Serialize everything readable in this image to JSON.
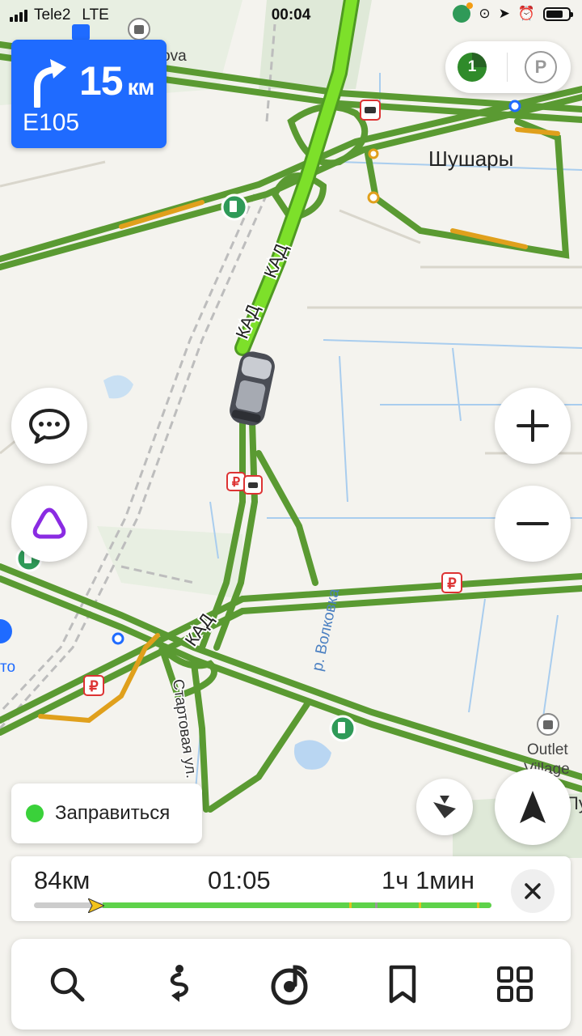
{
  "status_bar": {
    "carrier": "Tele2",
    "network": "LTE",
    "time": "00:04"
  },
  "maneuver": {
    "distance": "15",
    "unit": "км",
    "road": "E105"
  },
  "top_right": {
    "traffic_level": "1"
  },
  "map": {
    "place_shushary": "Шушары",
    "road_kad_1": "КАД",
    "road_kad_2": "КАД",
    "road_kad_3": "КАД",
    "river": "р. Волковка",
    "street": "Стартовая ул.",
    "street_partial_top": "ova",
    "outlet_line1": "Outlet",
    "outlet_line2": "Village",
    "left_edge_text": "то",
    "right_edge_text": "Пу"
  },
  "refuel_chip": {
    "label": "Заправиться"
  },
  "route": {
    "distance": "84км",
    "eta": "01:05",
    "duration": "1ч 1мин",
    "progress": 0.15
  },
  "colors": {
    "traffic_green": "#5a9a32",
    "traffic_yellow": "#e0a01c",
    "route_bright": "#7de02a",
    "accent_blue": "#1f6bff",
    "alice_purple": "#8a2be2"
  }
}
